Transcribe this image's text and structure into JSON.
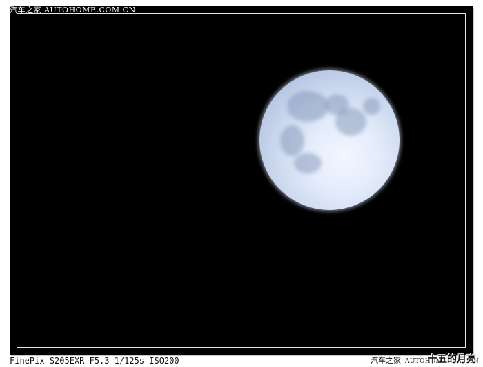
{
  "watermark": {
    "top_text": "汽车之家  AUTOHOME.COM.CN"
  },
  "photo": {
    "subject_icon": "moon-icon",
    "background_color": "#000000",
    "moon_color": "#e4ecfb"
  },
  "caption": {
    "exif": "FinePix S205EXR F5.3 1/125s ISO200",
    "brand_cn": "汽车之家",
    "brand_url": "AUTOHOME.COM.CN",
    "overlay": "十五的月亮"
  }
}
